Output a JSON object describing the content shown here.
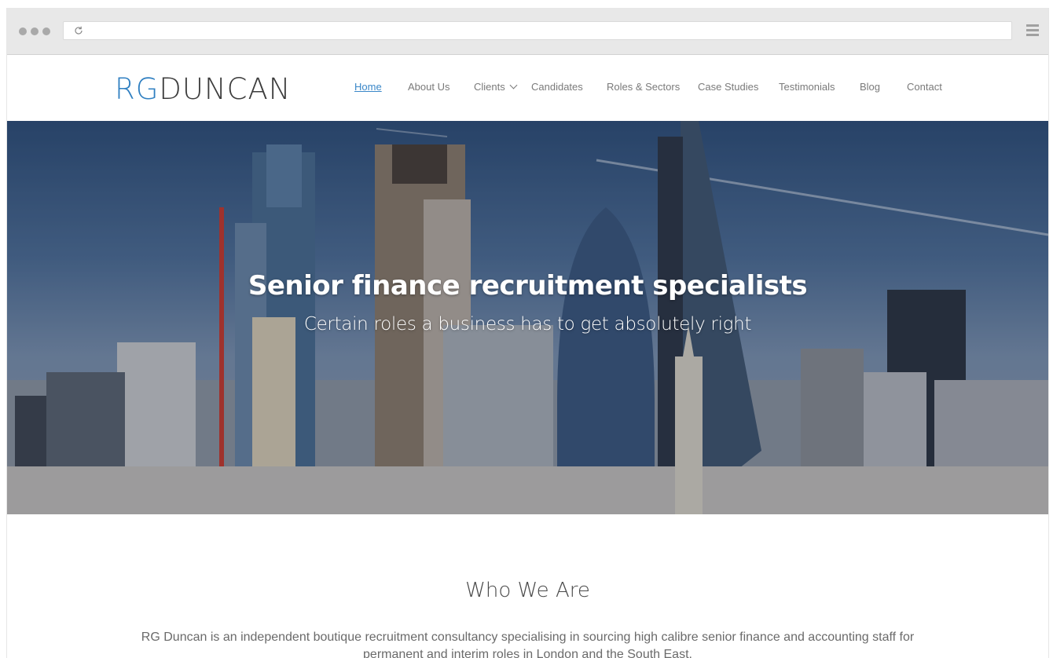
{
  "site": {
    "logo": {
      "part1": "RG",
      "part2": "DUNCAN"
    },
    "nav": [
      {
        "label": "Home",
        "active": true
      },
      {
        "label": "About Us"
      },
      {
        "label": "Clients",
        "has_dropdown": true
      },
      {
        "label": "Candidates"
      },
      {
        "label": "Roles & Sectors"
      },
      {
        "label": "Case Studies"
      },
      {
        "label": "Testimonials"
      },
      {
        "label": "Blog"
      },
      {
        "label": "Contact"
      }
    ]
  },
  "hero": {
    "title": "Senior finance recruitment specialists",
    "subtitle": "Certain roles a business has to get absolutely right"
  },
  "who_we_are": {
    "title": "Who We Are",
    "body": "RG Duncan is an independent boutique recruitment consultancy specialising in sourcing high calibre senior finance and accounting staff for permanent and interim roles in London and the South East."
  },
  "colors": {
    "brand_blue": "#2f7fc1",
    "logo_dark": "#3c3c3c",
    "nav_text": "#7a7a7a",
    "nav_active": "#3a87c8"
  },
  "icons": {
    "reload": "reload-icon",
    "menu": "hamburger-menu-icon",
    "dropdown": "chevron-down-icon"
  }
}
